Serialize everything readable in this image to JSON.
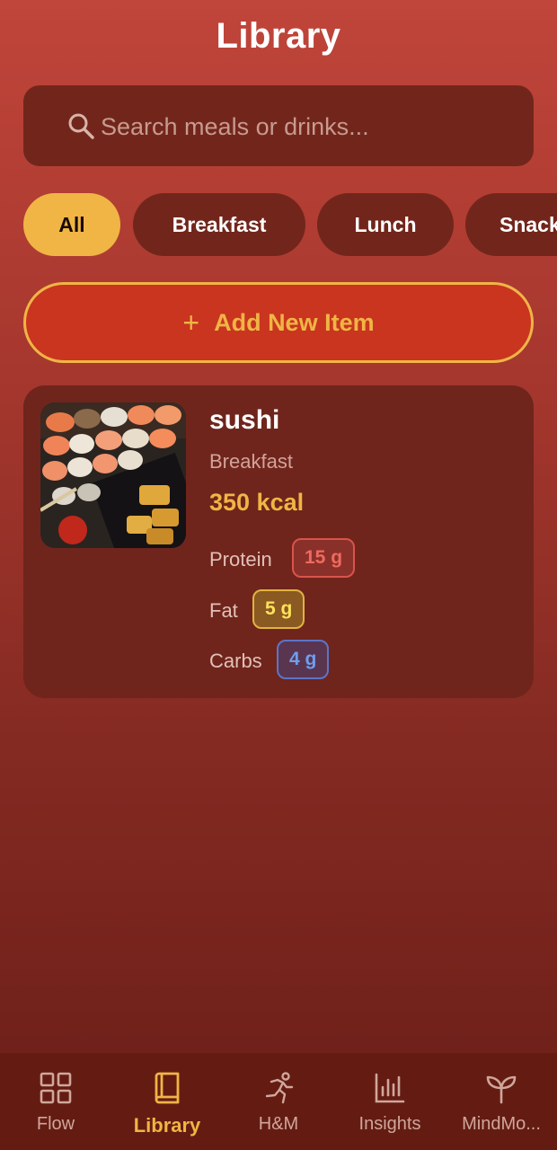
{
  "header": {
    "title": "Library"
  },
  "search": {
    "placeholder": "Search meals or drinks..."
  },
  "filters": [
    {
      "label": "All",
      "active": true
    },
    {
      "label": "Breakfast",
      "active": false
    },
    {
      "label": "Lunch",
      "active": false
    },
    {
      "label": "Snack",
      "active": false
    }
  ],
  "add_button": {
    "icon": "plus-icon",
    "label": "Add New Item"
  },
  "items": [
    {
      "name": "sushi",
      "category": "Breakfast",
      "calories": "350 kcal",
      "image": "sushi-photo",
      "macros": {
        "protein_label": "Protein",
        "protein_value": "15 g",
        "fat_label": "Fat",
        "fat_value": "5 g",
        "carbs_label": "Carbs",
        "carbs_value": "4 g"
      }
    }
  ],
  "nav": [
    {
      "label": "Flow",
      "icon": "grid-icon",
      "active": false
    },
    {
      "label": "Library",
      "icon": "book-icon",
      "active": true
    },
    {
      "label": "H&M",
      "icon": "runner-icon",
      "active": false
    },
    {
      "label": "Insights",
      "icon": "bar-chart-icon",
      "active": false
    },
    {
      "label": "MindMo...",
      "icon": "sprout-icon",
      "active": false
    }
  ],
  "colors": {
    "accent": "#f0b545",
    "card_bg": "#6f251c",
    "protein": "#ef6a5e",
    "fat": "#ffe15a",
    "carbs": "#6f9ff0"
  }
}
